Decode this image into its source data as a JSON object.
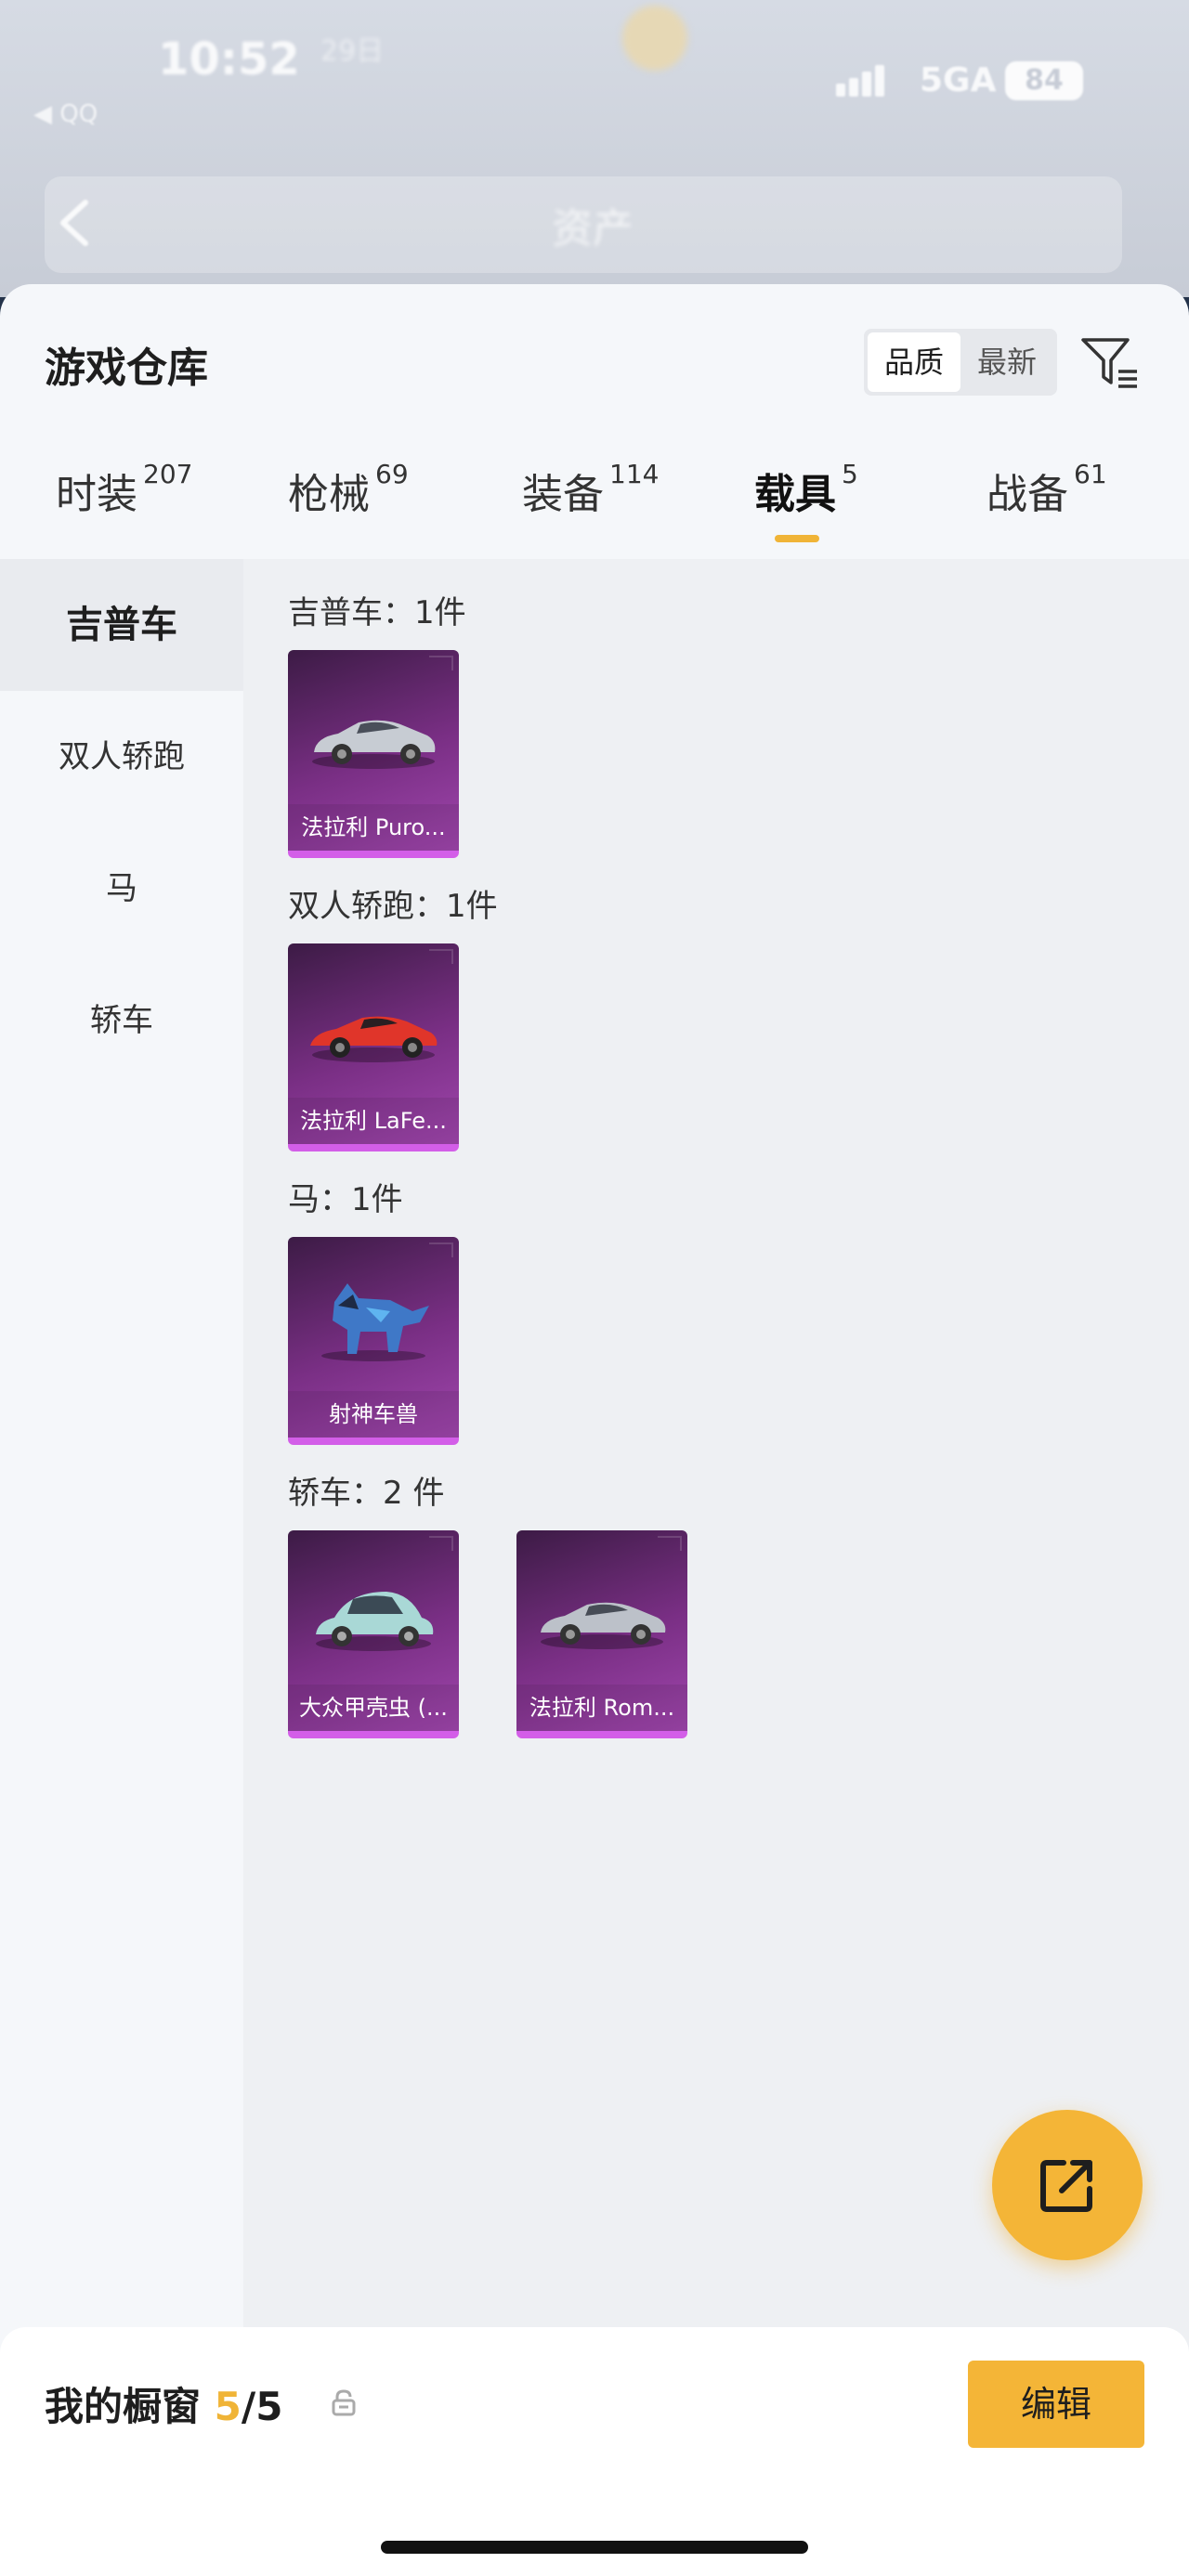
{
  "status_bar": {
    "time": "10:52",
    "date": "29日",
    "network": "5GA",
    "battery": "84"
  },
  "back_app": "◀ QQ",
  "nav": {
    "title": "资产"
  },
  "warehouse": {
    "title": "游戏仓库",
    "sort_options": [
      "品质",
      "最新"
    ],
    "active_sort": "品质"
  },
  "tabs": [
    {
      "label": "时装",
      "count": "207"
    },
    {
      "label": "枪械",
      "count": "69"
    },
    {
      "label": "装备",
      "count": "114"
    },
    {
      "label": "载具",
      "count": "5"
    },
    {
      "label": "战备",
      "count": "61"
    }
  ],
  "active_tab": "载具",
  "categories": [
    "吉普车",
    "双人轿跑",
    "马",
    "轿车"
  ],
  "active_category": "吉普车",
  "groups": [
    {
      "header": "吉普车：1件",
      "items": [
        {
          "name": "法拉利 Puro...",
          "icon": "silver-sports-car"
        }
      ]
    },
    {
      "header": "双人轿跑：1件",
      "items": [
        {
          "name": "法拉利 LaFe...",
          "icon": "red-supercar"
        }
      ]
    },
    {
      "header": "马：1件",
      "items": [
        {
          "name": "射神车兽",
          "icon": "blue-beast-mount"
        }
      ]
    },
    {
      "header": "轿车：2 件",
      "items": [
        {
          "name": "大众甲壳虫 (...",
          "icon": "mint-beetle-car"
        },
        {
          "name": "法拉利 Rom...",
          "icon": "silver-coupe-car"
        }
      ]
    }
  ],
  "card_colors": {
    "background": "#7a2f85",
    "accent": "#d35ee8"
  },
  "share_button": {
    "icon": "share-external-icon",
    "color": "#f4b537"
  },
  "showcase": {
    "label": "我的橱窗",
    "count": "5",
    "total": "/5"
  },
  "edit_label": "编辑"
}
